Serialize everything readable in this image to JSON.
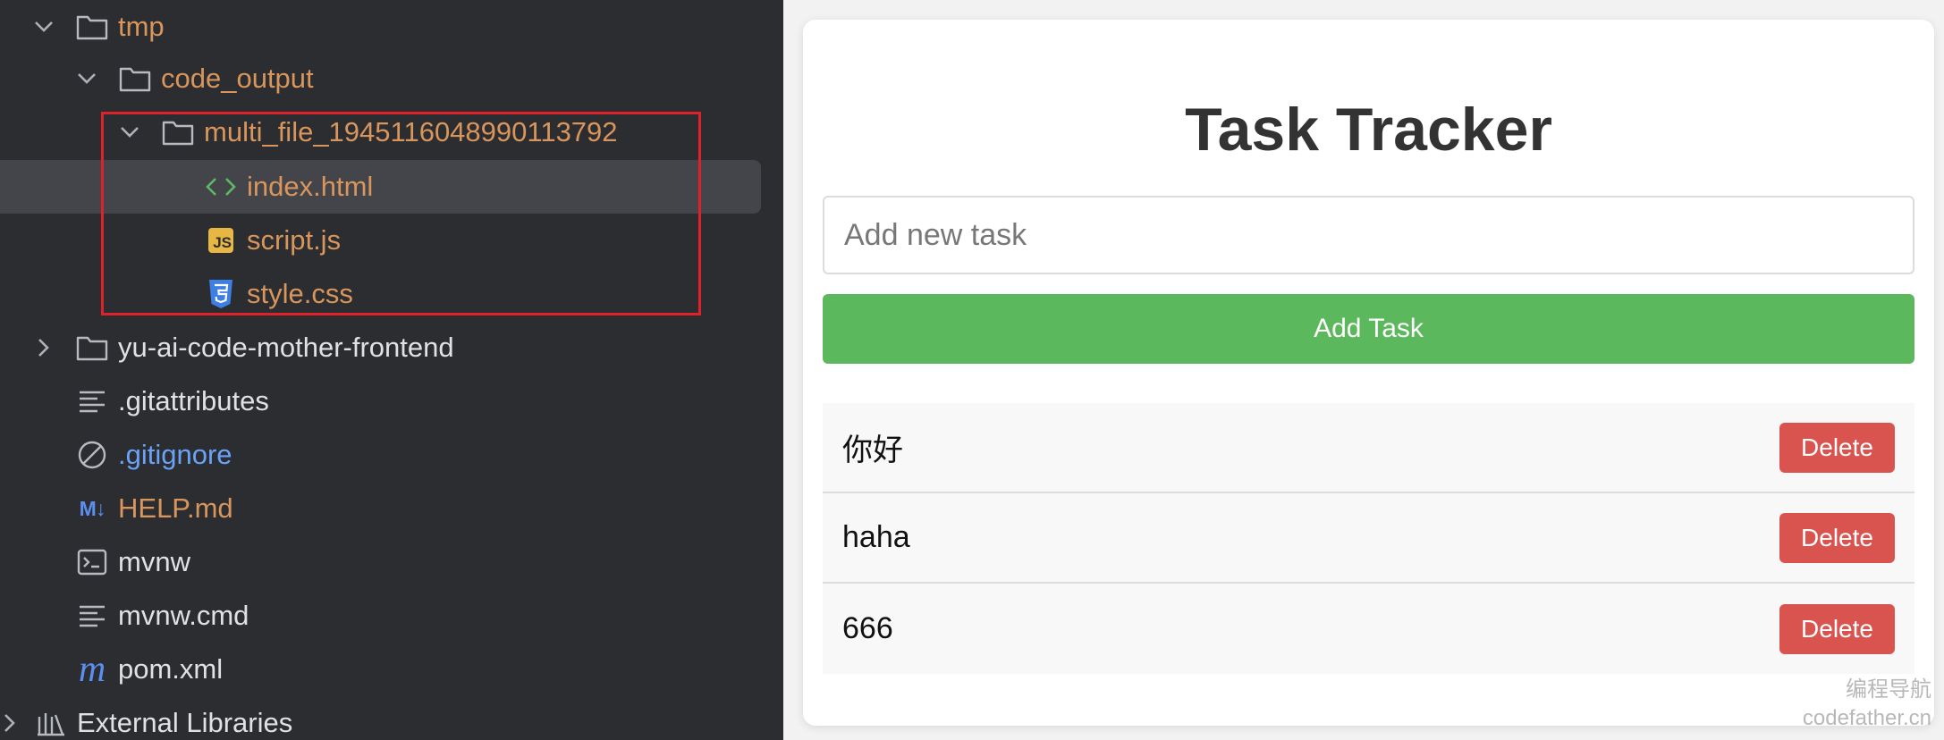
{
  "tree": {
    "items": [
      {
        "label": "tmp",
        "icon": "folder-icon",
        "expanded": true
      },
      {
        "label": "code_output",
        "icon": "folder-icon",
        "expanded": true
      },
      {
        "label": "multi_file_1945116048990113792",
        "icon": "folder-icon",
        "expanded": true
      },
      {
        "label": "index.html",
        "icon": "html-file-icon"
      },
      {
        "label": "script.js",
        "icon": "js-file-icon"
      },
      {
        "label": "style.css",
        "icon": "css-file-icon"
      },
      {
        "label": "yu-ai-code-mother-frontend",
        "icon": "folder-icon",
        "expanded": false
      },
      {
        "label": ".gitattributes",
        "icon": "text-file-icon"
      },
      {
        "label": ".gitignore",
        "icon": "ignore-file-icon"
      },
      {
        "label": "HELP.md",
        "icon": "markdown-file-icon",
        "badge": "M↓"
      },
      {
        "label": "mvnw",
        "icon": "terminal-file-icon"
      },
      {
        "label": "mvnw.cmd",
        "icon": "text-file-icon"
      },
      {
        "label": "pom.xml",
        "icon": "maven-file-icon",
        "badge": "m"
      },
      {
        "label": "External Libraries",
        "icon": "library-icon",
        "expanded": false
      }
    ],
    "js_badge": "JS",
    "colors": {
      "background": "#2b2d30",
      "selected_row": "#43454a",
      "highlight_box": "#e0212a",
      "orange_text": "#d8955c",
      "blue_text": "#6aa2f7"
    }
  },
  "app": {
    "title": "Task Tracker",
    "input_placeholder": "Add new task",
    "add_button": "Add Task",
    "tasks": [
      {
        "text": "你好",
        "delete_label": "Delete"
      },
      {
        "text": "haha",
        "delete_label": "Delete"
      },
      {
        "text": "666",
        "delete_label": "Delete"
      }
    ],
    "colors": {
      "add_button": "#5cb85c",
      "delete_button": "#d9534f"
    }
  },
  "watermark": {
    "line1": "编程导航",
    "line2": "codefather.cn"
  }
}
